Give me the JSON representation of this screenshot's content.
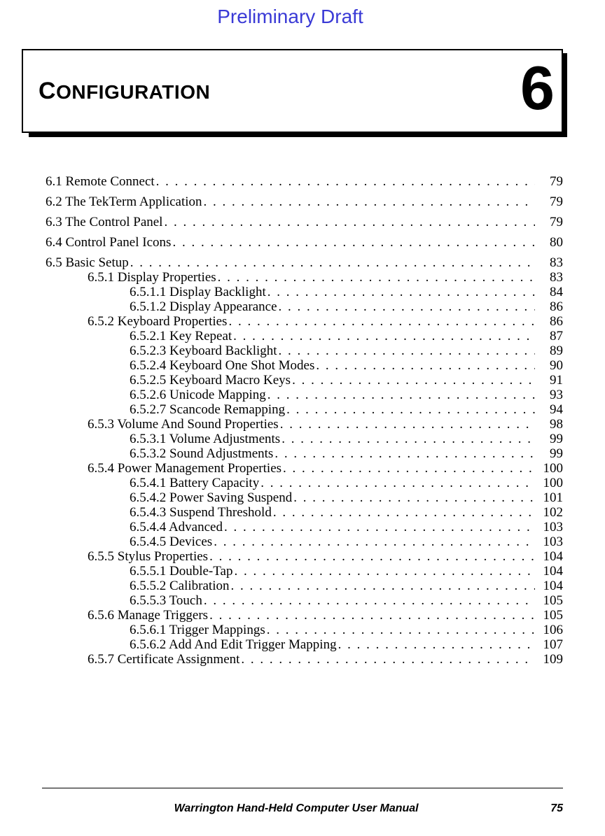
{
  "draft_label": "Preliminary Draft",
  "chapter": {
    "title_first_letter": "C",
    "title_rest": "ONFIGURATION",
    "number": "6"
  },
  "toc": [
    {
      "level": 0,
      "title": "6.1 Remote Connect",
      "page": "79"
    },
    {
      "level": 0,
      "title": "6.2 The TekTerm Application",
      "page": "79"
    },
    {
      "level": 0,
      "title": "6.3 The Control Panel",
      "page": "79"
    },
    {
      "level": 0,
      "title": "6.4 Control Panel Icons",
      "page": "80"
    },
    {
      "level": 0,
      "title": "6.5 Basic Setup",
      "page": "83"
    },
    {
      "level": 1,
      "title": "6.5.1 Display Properties",
      "page": "83"
    },
    {
      "level": 2,
      "title": "6.5.1.1 Display Backlight",
      "page": "84"
    },
    {
      "level": 2,
      "title": "6.5.1.2 Display Appearance",
      "page": "86"
    },
    {
      "level": 1,
      "title": "6.5.2 Keyboard Properties",
      "page": "86"
    },
    {
      "level": 2,
      "title": "6.5.2.1 Key Repeat",
      "page": "87"
    },
    {
      "level": 2,
      "title": "6.5.2.3 Keyboard Backlight",
      "page": "89"
    },
    {
      "level": 2,
      "title": "6.5.2.4 Keyboard One Shot Modes",
      "page": "90"
    },
    {
      "level": 2,
      "title": "6.5.2.5 Keyboard Macro Keys",
      "page": "91"
    },
    {
      "level": 2,
      "title": "6.5.2.6 Unicode Mapping",
      "page": "93"
    },
    {
      "level": 2,
      "title": "6.5.2.7 Scancode Remapping",
      "page": "94"
    },
    {
      "level": 1,
      "title": "6.5.3 Volume And Sound Properties",
      "page": "98"
    },
    {
      "level": 2,
      "title": "6.5.3.1 Volume Adjustments",
      "page": "99"
    },
    {
      "level": 2,
      "title": "6.5.3.2 Sound Adjustments",
      "page": "99"
    },
    {
      "level": 1,
      "title": "6.5.4 Power Management Properties",
      "page": "100"
    },
    {
      "level": 2,
      "title": "6.5.4.1 Battery Capacity",
      "page": "100"
    },
    {
      "level": 2,
      "title": "6.5.4.2 Power Saving Suspend",
      "page": "101"
    },
    {
      "level": 2,
      "title": "6.5.4.3 Suspend Threshold",
      "page": "102"
    },
    {
      "level": 2,
      "title": "6.5.4.4 Advanced",
      "page": "103"
    },
    {
      "level": 2,
      "title": "6.5.4.5 Devices",
      "page": "103"
    },
    {
      "level": 1,
      "title": "6.5.5 Stylus Properties",
      "page": "104"
    },
    {
      "level": 2,
      "title": "6.5.5.1 Double-Tap",
      "page": "104"
    },
    {
      "level": 2,
      "title": "6.5.5.2 Calibration",
      "page": "104"
    },
    {
      "level": 2,
      "title": "6.5.5.3 Touch",
      "page": "105"
    },
    {
      "level": 1,
      "title": "6.5.6 Manage Triggers",
      "page": "105"
    },
    {
      "level": 2,
      "title": "6.5.6.1 Trigger Mappings",
      "page": "106"
    },
    {
      "level": 2,
      "title": "6.5.6.2 Add And Edit Trigger Mapping",
      "page": "107"
    },
    {
      "level": 1,
      "title": "6.5.7 Certificate Assignment",
      "page": "109"
    }
  ],
  "footer": {
    "book_title": "Warrington Hand-Held Computer User Manual",
    "page_number": "75"
  }
}
